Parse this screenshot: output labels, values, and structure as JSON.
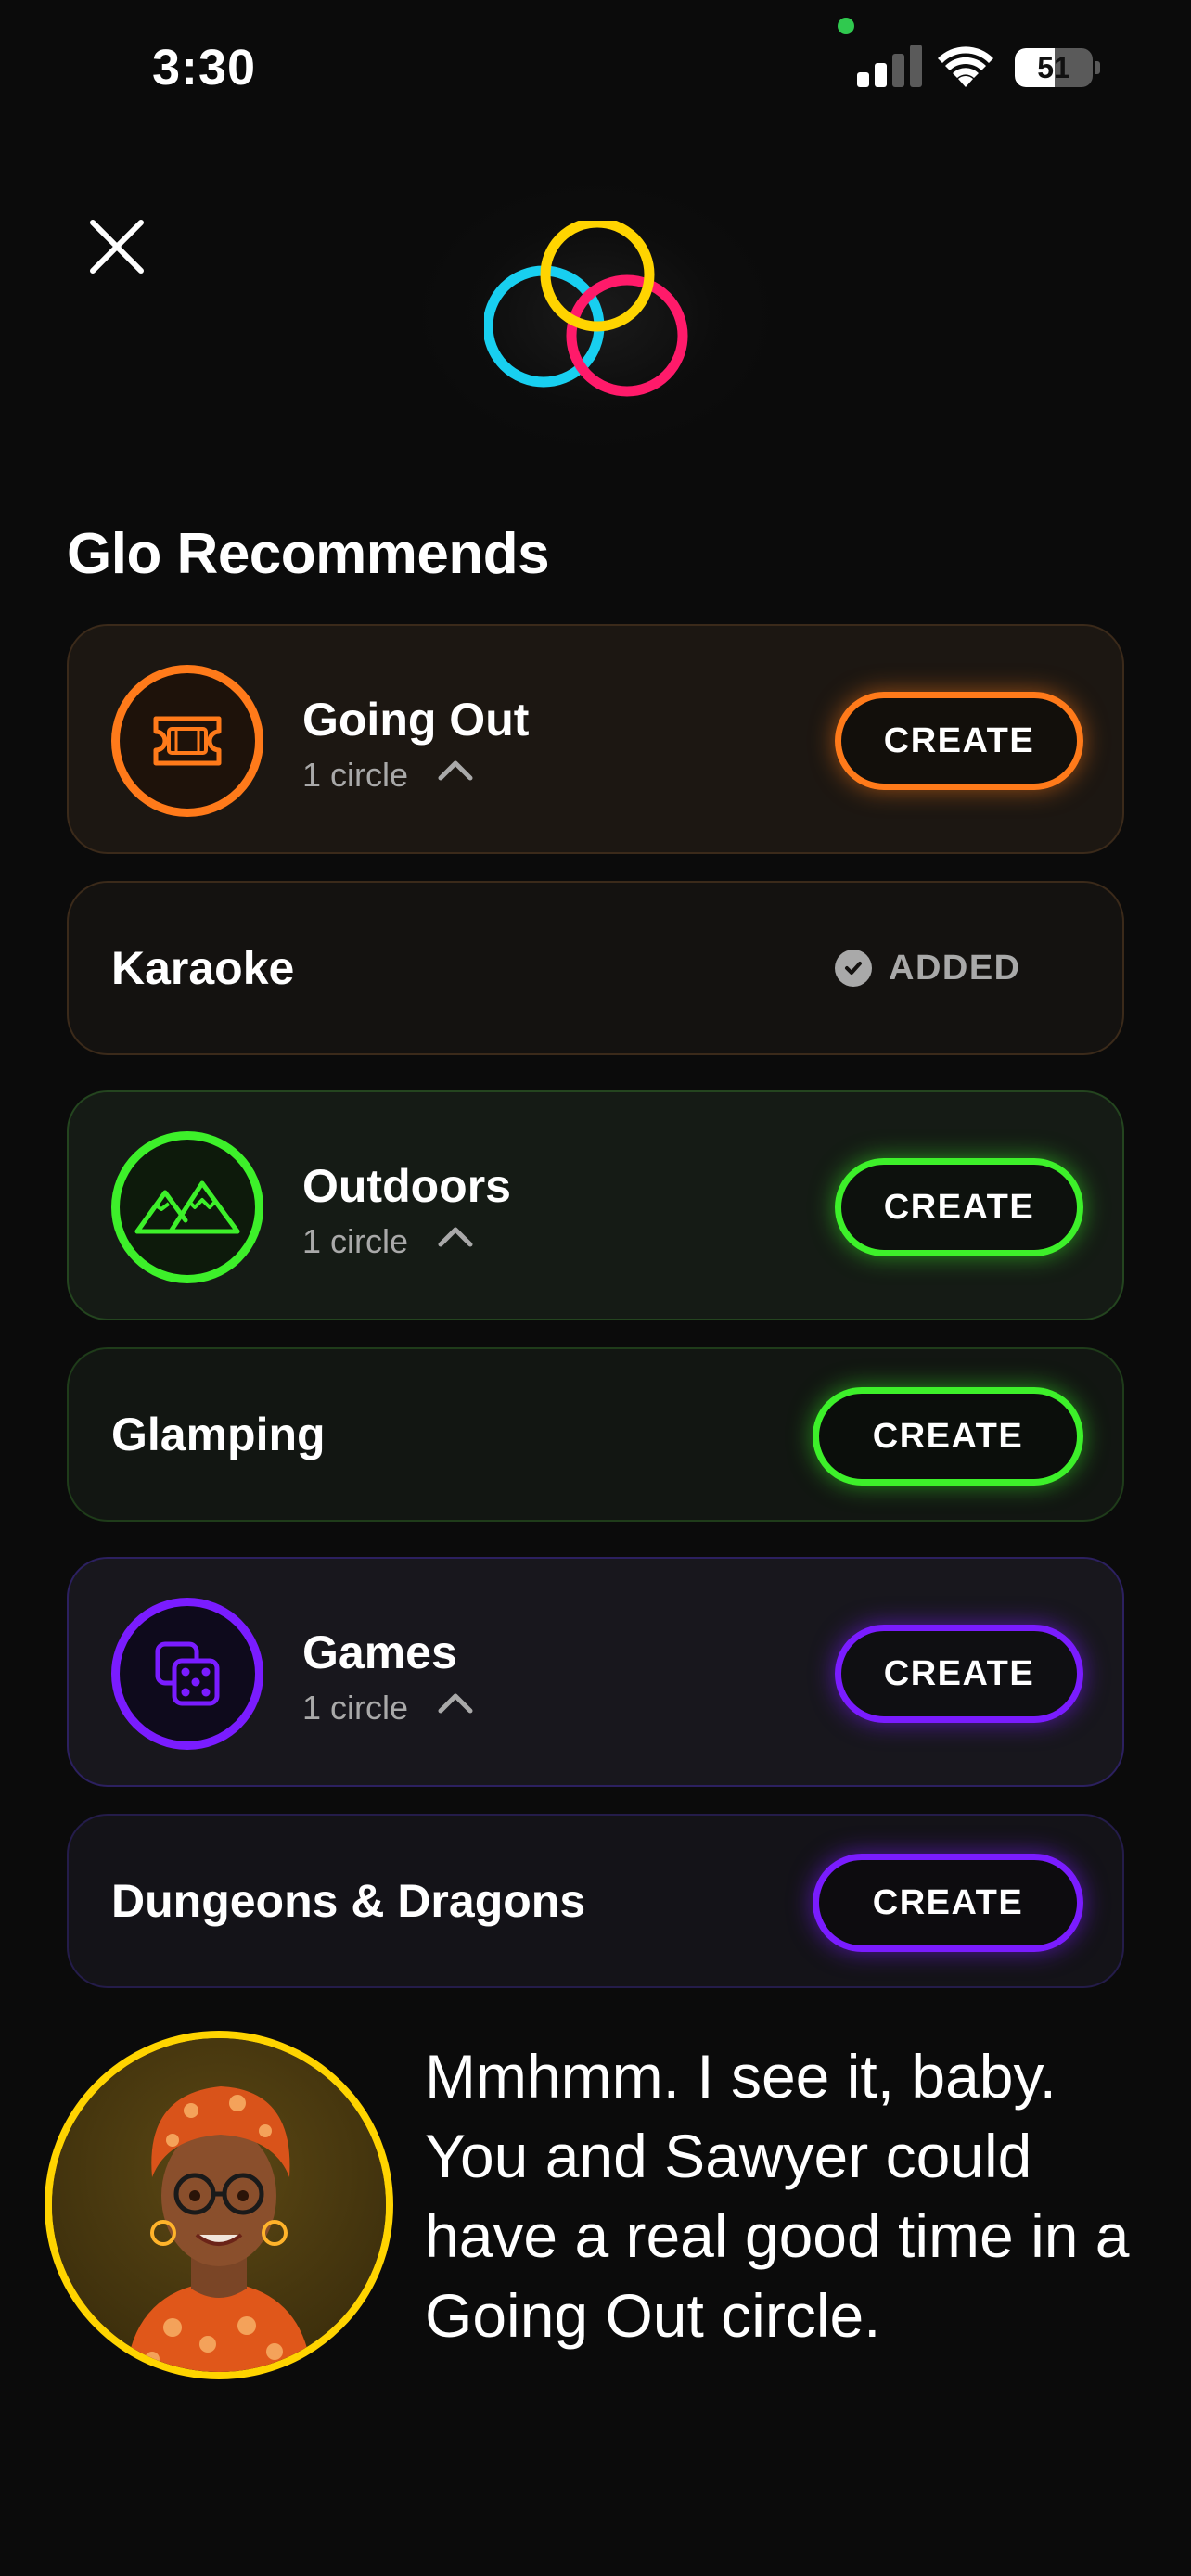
{
  "status_bar": {
    "time": "3:30",
    "battery_level": "51",
    "battery_fraction": 0.51,
    "signal_bars_active": 2,
    "icons": [
      "cellular-signal-icon",
      "wifi-icon",
      "battery-icon"
    ]
  },
  "header": {
    "close_icon": "close-icon",
    "logo_icon": "three-rings-logo",
    "logo_colors": [
      "#ffd400",
      "#18cff0",
      "#ff1a6a"
    ]
  },
  "section": {
    "title": "Glo Recommends"
  },
  "categories": [
    {
      "name": "Going Out",
      "sub": "1 circle",
      "icon": "ticket-icon",
      "color": "#ff7a1a",
      "button": "CREATE",
      "recommendation": {
        "name": "Karaoke",
        "status": "ADDED"
      }
    },
    {
      "name": "Outdoors",
      "sub": "1 circle",
      "icon": "mountains-icon",
      "color": "#3df02a",
      "button": "CREATE",
      "recommendation": {
        "name": "Glamping",
        "button": "CREATE"
      }
    },
    {
      "name": "Games",
      "sub": "1 circle",
      "icon": "dice-icon",
      "color": "#7a1cff",
      "button": "CREATE",
      "recommendation": {
        "name": "Dungeons & Dragons",
        "button": "CREATE"
      }
    }
  ],
  "assistant": {
    "avatar_icon": "assistant-avatar",
    "message": "Mmhmm. I see it, baby. You and Sawyer could have a real good time in a Going Out circle."
  }
}
